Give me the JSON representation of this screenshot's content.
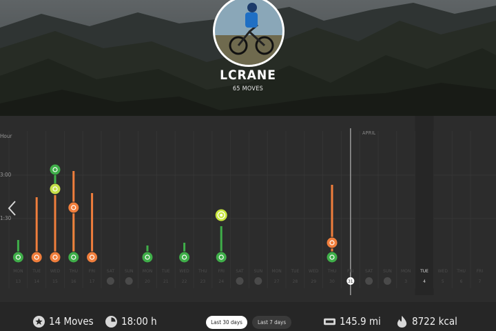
{
  "profile": {
    "username": "LCRANE",
    "moves": "65 MOVES"
  },
  "timeline": {
    "axis": {
      "hour": "Hour",
      "t1": "3:00",
      "t2": "1:30"
    },
    "month": "APRIL",
    "days": [
      {
        "dow": "MON",
        "d": "13"
      },
      {
        "dow": "TUE",
        "d": "14"
      },
      {
        "dow": "WED",
        "d": "15"
      },
      {
        "dow": "THU",
        "d": "16"
      },
      {
        "dow": "FRI",
        "d": "17"
      },
      {
        "dow": "SAT",
        "d": "18"
      },
      {
        "dow": "SUN",
        "d": "19"
      },
      {
        "dow": "MON",
        "d": "20"
      },
      {
        "dow": "TUE",
        "d": "21"
      },
      {
        "dow": "WED",
        "d": "22"
      },
      {
        "dow": "THU",
        "d": "23"
      },
      {
        "dow": "FRI",
        "d": "24"
      },
      {
        "dow": "SAT",
        "d": "25"
      },
      {
        "dow": "SUN",
        "d": "26"
      },
      {
        "dow": "MON",
        "d": "27"
      },
      {
        "dow": "TUE",
        "d": "28"
      },
      {
        "dow": "WED",
        "d": "29"
      },
      {
        "dow": "THU",
        "d": "30"
      },
      {
        "dow": "FRI",
        "d": "31"
      },
      {
        "dow": "SAT",
        "d": "1"
      },
      {
        "dow": "SUN",
        "d": "2"
      },
      {
        "dow": "MON",
        "d": "3"
      },
      {
        "dow": "TUE",
        "d": "4"
      },
      {
        "dow": "WED",
        "d": "5"
      },
      {
        "dow": "THU",
        "d": "6"
      },
      {
        "dow": "FRI",
        "d": "7"
      }
    ],
    "today_dow": "TUE",
    "today_day": "4"
  },
  "colors": {
    "cycling": "#f07e3c",
    "hiking": "#3fae49",
    "skating": "#c6e04a",
    "climbing": "#c8e63b",
    "accent": "#ffffff"
  },
  "icons": {
    "cycling": "bicycle-icon",
    "hiking": "hiking-boot-icon",
    "skating": "inline-skate-icon",
    "climbing": "climbing-icon",
    "stats": [
      "star-icon",
      "clock-icon",
      "distance-icon",
      "flame-icon"
    ]
  },
  "summary": {
    "moves": "14 Moves",
    "duration": "18:00 h",
    "distance": "145.9 mi",
    "calories": "8722 kcal"
  },
  "tabs": {
    "last30": "Last 30 days",
    "last7": "Last 7 days"
  }
}
